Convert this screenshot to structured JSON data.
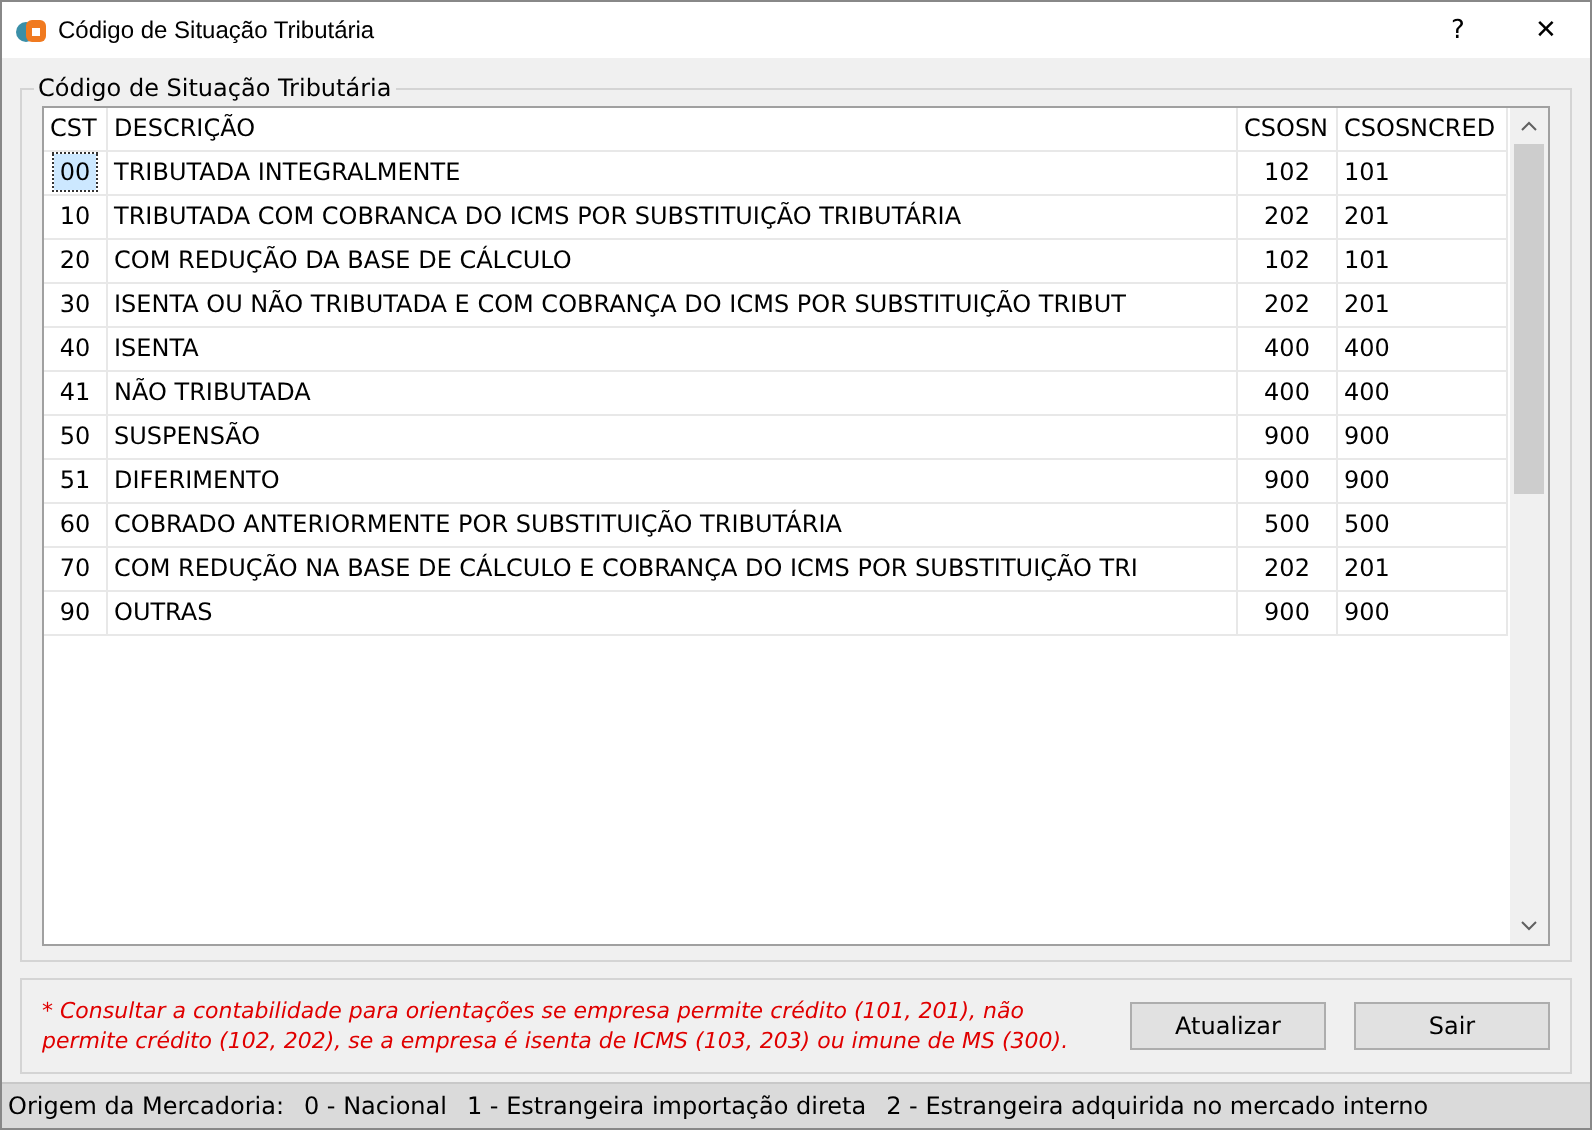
{
  "window": {
    "title": "Código de Situação Tributária",
    "help": "?",
    "close": "✕"
  },
  "group": {
    "title": "Código de Situação Tributária"
  },
  "table": {
    "columns": [
      "CST",
      "DESCRIÇÃO",
      "CSOSN",
      "CSOSNCRED"
    ],
    "rows": [
      {
        "cst": "00",
        "descricao": "TRIBUTADA INTEGRALMENTE",
        "csosn": "102",
        "csosncred": "101",
        "selected": true
      },
      {
        "cst": "10",
        "descricao": "TRIBUTADA COM COBRANCA DO ICMS POR SUBSTITUIÇÃO TRIBUTÁRIA",
        "csosn": "202",
        "csosncred": "201",
        "selected": false
      },
      {
        "cst": "20",
        "descricao": "COM REDUÇÃO DA BASE DE CÁLCULO",
        "csosn": "102",
        "csosncred": "101",
        "selected": false
      },
      {
        "cst": "30",
        "descricao": "ISENTA OU NÃO TRIBUTADA E COM COBRANÇA DO ICMS POR SUBSTITUIÇÃO TRIBUT",
        "csosn": "202",
        "csosncred": "201",
        "selected": false
      },
      {
        "cst": "40",
        "descricao": "ISENTA",
        "csosn": "400",
        "csosncred": "400",
        "selected": false
      },
      {
        "cst": "41",
        "descricao": "NÃO TRIBUTADA",
        "csosn": "400",
        "csosncred": "400",
        "selected": false
      },
      {
        "cst": "50",
        "descricao": "SUSPENSÃO",
        "csosn": "900",
        "csosncred": "900",
        "selected": false
      },
      {
        "cst": "51",
        "descricao": "DIFERIMENTO",
        "csosn": "900",
        "csosncred": "900",
        "selected": false
      },
      {
        "cst": "60",
        "descricao": "COBRADO ANTERIORMENTE POR SUBSTITUIÇÃO TRIBUTÁRIA",
        "csosn": "500",
        "csosncred": "500",
        "selected": false
      },
      {
        "cst": "70",
        "descricao": "COM REDUÇÃO NA BASE DE CÁLCULO E COBRANÇA DO ICMS POR SUBSTITUIÇÃO TRI",
        "csosn": "202",
        "csosncred": "201",
        "selected": false
      },
      {
        "cst": "90",
        "descricao": "OUTRAS",
        "csosn": "900",
        "csosncred": "900",
        "selected": false
      }
    ]
  },
  "note": "* Consultar a contabilidade para orientações se empresa permite crédito (101, 201), não permite crédito (102, 202), se a empresa é isenta de ICMS (103, 203) ou imune de MS (300).",
  "buttons": [
    "Atualizar",
    "Sair"
  ],
  "status_bar": {
    "label": "Origem da Mercadoria:",
    "items": [
      "0 - Nacional",
      "1 - Estrangeira importação direta",
      "2 - Estrangeira adquirida no mercado interno"
    ]
  }
}
